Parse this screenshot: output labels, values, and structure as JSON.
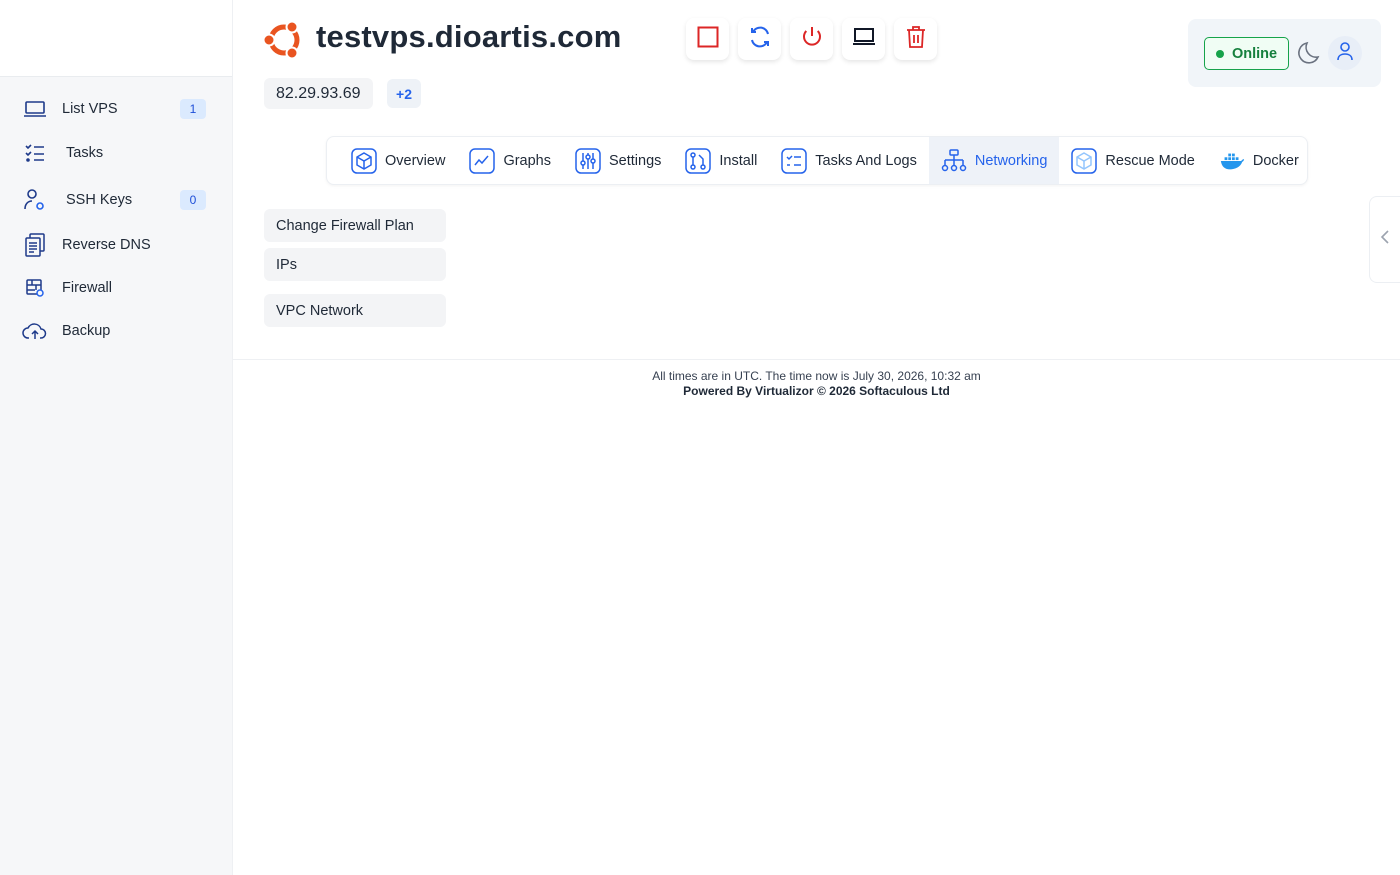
{
  "sidebar": {
    "items": [
      {
        "label": "List VPS",
        "badge": "1",
        "icon": "laptop-icon"
      },
      {
        "label": "Tasks",
        "icon": "checklist-icon"
      },
      {
        "label": "SSH Keys",
        "badge": "0",
        "icon": "user-key-icon"
      },
      {
        "label": "Reverse DNS",
        "icon": "documents-icon"
      },
      {
        "label": "Firewall",
        "icon": "firewall-icon"
      },
      {
        "label": "Backup",
        "icon": "cloud-upload-icon"
      }
    ]
  },
  "header": {
    "hostname": "testvps.dioartis.com",
    "os_icon": "ubuntu-icon",
    "ip": "82.29.93.69",
    "ip_more": "+2",
    "actions": [
      "stop-icon",
      "restart-icon",
      "power-icon",
      "console-icon",
      "delete-icon"
    ]
  },
  "status": {
    "label": "Online",
    "color": "#16a34a"
  },
  "tabs": [
    {
      "label": "Overview",
      "icon": "cube-icon"
    },
    {
      "label": "Graphs",
      "icon": "line-chart-icon"
    },
    {
      "label": "Settings",
      "icon": "sliders-icon"
    },
    {
      "label": "Install",
      "icon": "git-icon"
    },
    {
      "label": "Tasks And Logs",
      "icon": "list-icon"
    },
    {
      "label": "Networking",
      "icon": "network-icon",
      "active": true
    },
    {
      "label": "Rescue Mode",
      "icon": "rescue-cube-icon"
    },
    {
      "label": "Docker",
      "icon": "docker-icon"
    }
  ],
  "networking_menu": [
    {
      "label": "Change Firewall Plan"
    },
    {
      "label": "IPs"
    },
    {
      "label": "VPC Network"
    }
  ],
  "footer": {
    "time_text": "All times are in UTC. The time now is July 30, 2026, 10:32 am",
    "powered_text": "Powered By Virtualizor © 2026 Softaculous Ltd"
  },
  "colors": {
    "accent": "#2563eb",
    "danger": "#dc2626",
    "ubuntu": "#e95420"
  }
}
